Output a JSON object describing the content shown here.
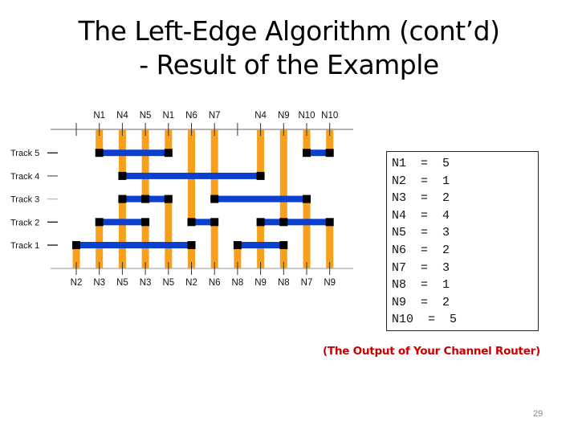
{
  "slide": {
    "title_line1": "The Left-Edge Algorithm (cont’d)",
    "title_line2": "- Result of the Example",
    "caption": "(The Output of Your Channel Router)",
    "page_number": "29"
  },
  "diagram": {
    "colors": {
      "vertical_wire": "#f7a01c",
      "horizontal_wire": "#0a3fcf",
      "via": "#000000",
      "channel_edge": "#888888"
    },
    "tracks": [
      {
        "label": "Track 5",
        "number": 5
      },
      {
        "label": "Track 4",
        "number": 4
      },
      {
        "label": "Track 3",
        "number": 3
      },
      {
        "label": "Track 2",
        "number": 2
      },
      {
        "label": "Track 1",
        "number": 1
      }
    ],
    "top_pins": [
      "",
      "N1",
      "N4",
      "N5",
      "N1",
      "N6",
      "N7",
      "",
      "N4",
      "N9",
      "N10",
      "N10"
    ],
    "bottom_pins": [
      "N2",
      "N3",
      "N5",
      "N3",
      "N5",
      "N2",
      "N6",
      "N8",
      "N9",
      "N8",
      "N7",
      "N9"
    ],
    "nets": [
      {
        "name": "N1",
        "track": 5,
        "from_col": 1,
        "to_col": 4
      },
      {
        "name": "N2",
        "track": 1,
        "from_col": 0,
        "to_col": 5
      },
      {
        "name": "N3",
        "track": 2,
        "from_col": 1,
        "to_col": 3
      },
      {
        "name": "N4",
        "track": 4,
        "from_col": 2,
        "to_col": 8
      },
      {
        "name": "N5",
        "track": 3,
        "from_col": 2,
        "to_col": 4
      },
      {
        "name": "N6",
        "track": 2,
        "from_col": 5,
        "to_col": 6
      },
      {
        "name": "N7",
        "track": 3,
        "from_col": 6,
        "to_col": 10
      },
      {
        "name": "N8",
        "track": 1,
        "from_col": 7,
        "to_col": 9
      },
      {
        "name": "N9",
        "track": 2,
        "from_col": 8,
        "to_col": 11
      },
      {
        "name": "N10",
        "track": 5,
        "from_col": 10,
        "to_col": 11
      }
    ]
  },
  "result": {
    "lines": [
      "N1  =  5",
      "N2  =  1",
      "N3  =  2",
      "N4  =  4",
      "N5  =  3",
      "N6  =  2",
      "N7  =  3",
      "N8  =  1",
      "N9  =  2",
      "N10  =  5"
    ]
  }
}
